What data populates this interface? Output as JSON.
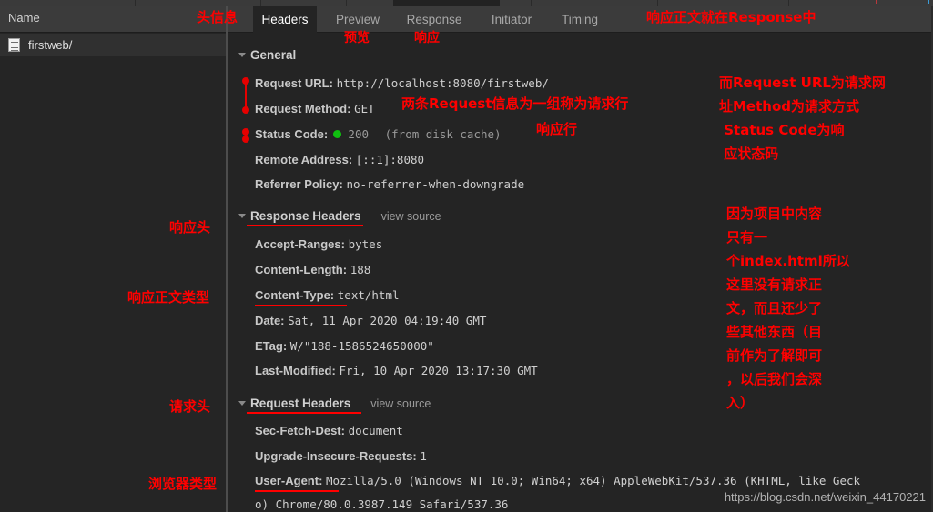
{
  "left_panel": {
    "column_header": "Name",
    "rows": [
      {
        "icon": "document-icon",
        "label": "firstweb/"
      }
    ]
  },
  "tabs": [
    {
      "id": "headers",
      "label": "Headers",
      "active": true
    },
    {
      "id": "preview",
      "label": "Preview",
      "active": false
    },
    {
      "id": "response",
      "label": "Response",
      "active": false
    },
    {
      "id": "initiator",
      "label": "Initiator",
      "active": false
    },
    {
      "id": "timing",
      "label": "Timing",
      "active": false
    }
  ],
  "sections": {
    "general": {
      "title": "General",
      "rows": [
        {
          "key": "Request URL:",
          "value": "http://localhost:8080/firstweb/"
        },
        {
          "key": "Request Method:",
          "value": "GET"
        },
        {
          "key": "Status Code:",
          "value": "200",
          "suffix": "(from disk cache)",
          "dot_color": "#10c010"
        },
        {
          "key": "Remote Address:",
          "value": "[::1]:8080"
        },
        {
          "key": "Referrer Policy:",
          "value": "no-referrer-when-downgrade"
        }
      ]
    },
    "response_headers": {
      "title": "Response Headers",
      "view_source": "view source",
      "rows": [
        {
          "key": "Accept-Ranges:",
          "value": "bytes"
        },
        {
          "key": "Content-Length:",
          "value": "188"
        },
        {
          "key": "Content-Type:",
          "value": "text/html"
        },
        {
          "key": "Date:",
          "value": "Sat, 11 Apr 2020 04:19:40 GMT"
        },
        {
          "key": "ETag:",
          "value": "W/\"188-1586524650000\""
        },
        {
          "key": "Last-Modified:",
          "value": "Fri, 10 Apr 2020 13:17:30 GMT"
        }
      ]
    },
    "request_headers": {
      "title": "Request Headers",
      "view_source": "view source",
      "rows": [
        {
          "key": "Sec-Fetch-Dest:",
          "value": "document"
        },
        {
          "key": "Upgrade-Insecure-Requests:",
          "value": "1"
        },
        {
          "key": "User-Agent:",
          "value": "Mozilla/5.0 (Windows NT 10.0; Win64; x64) AppleWebKit/537.36 (KHTML, like Geck"
        },
        {
          "key": "",
          "value": "o) Chrome/80.0.3987.149 Safari/537.36"
        }
      ]
    }
  },
  "annotations": {
    "color": "#ff0000",
    "head_info": "头信息",
    "preview": "预览",
    "response": "响应",
    "response_body_note": "响应正文就在Response中",
    "request_line_note": "两条Request信息为一组称为请求行",
    "status_line": "响应行",
    "request_url_note": "而Request URL为请求网\n址Method为请求方式\n Status Code为响\n 应状态码",
    "response_header": "响应头",
    "response_body_type": "响应正文类型",
    "request_header": "请求头",
    "browser_type": "浏览器类型",
    "project_note": "因为项目中内容\n只有一\n个index.html所以\n这里没有请求正\n文，而且还少了\n些其他东西（目\n前作为了解即可\n，以后我们会深\n入）"
  },
  "watermark": "https://blog.csdn.net/weixin_44170221"
}
